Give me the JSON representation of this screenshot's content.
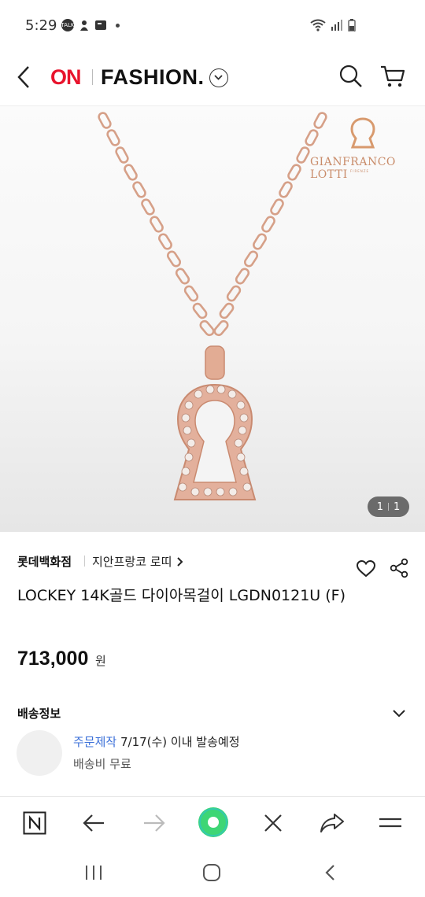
{
  "status_bar": {
    "time": "5:29",
    "talk_badge": "TALK"
  },
  "header": {
    "logo_on": "ON",
    "logo_fashion": "FASHION."
  },
  "product_image": {
    "brand_logo_text": "GIANFRANCO LOTTI",
    "brand_logo_sub": "FIRENZE",
    "pager_current": "1",
    "pager_total": "1"
  },
  "product": {
    "seller": "롯데백화점",
    "brand": "지안프랑코 로띠",
    "title": "LOCKEY 14K골드 다이아목걸이 LGDN0121U (F)",
    "price": "713,000",
    "price_unit": "원"
  },
  "shipping": {
    "label": "배송정보",
    "highlight": "주문제작",
    "detail": " 7/17(수) 이내 발송예정",
    "fee": "배송비 무료"
  },
  "browser_bar": {
    "n_label": "N"
  },
  "colors": {
    "brand_red": "#e8142d",
    "link_blue": "#3a6fd8",
    "rose_gold": "#d49a82",
    "fab_green": "#3ed675"
  }
}
